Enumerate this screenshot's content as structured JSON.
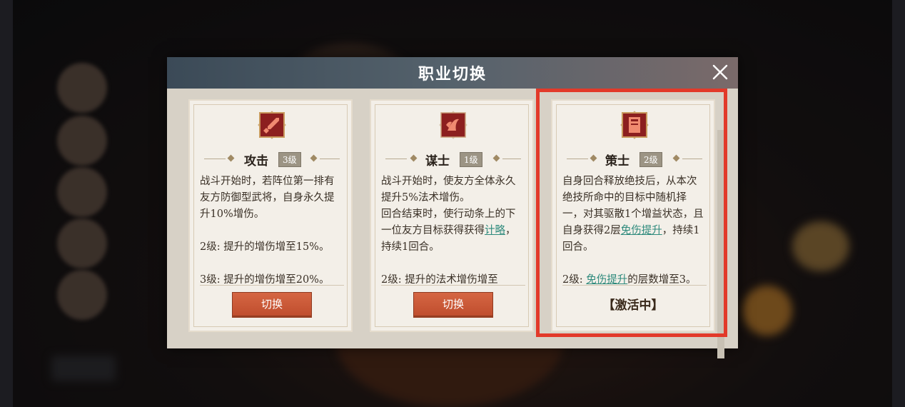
{
  "modal": {
    "title": "职业切换",
    "close_icon": "close-icon"
  },
  "cards": [
    {
      "name": "攻击",
      "level": "3级",
      "icon": "sword-icon",
      "desc": [
        "战斗开始时，若阵位第一排有友方防御型武将，自身永久提升10%增伤。",
        "2级: 提升的增伤增至15%。",
        "3级: 提升的增伤增至20%。"
      ],
      "button": "切换"
    },
    {
      "name": "谋士",
      "level": "1级",
      "icon": "claw-icon",
      "desc_p1": "战斗开始时，使友方全体永久提升5%法术增伤。",
      "desc_p2a": "回合结束时，使行动条上的下一位友方目标获得获得",
      "desc_p2_link": "计略",
      "desc_p2b": "，持续1回合。",
      "desc_p3": "2级: 提升的法术增伤增至",
      "button": "切换"
    },
    {
      "name": "策士",
      "level": "2级",
      "icon": "book-icon",
      "desc_p1a": "自身回合释放绝技后，从本次绝技所命中的目标中随机择一，对其驱散1个增益状态，且自身获得2层",
      "desc_p1_link": "免伤提升",
      "desc_p1b": "，持续1回合。",
      "desc_p2a": "2级: ",
      "desc_p2_link": "免伤提升",
      "desc_p2b": "的层数增至3。",
      "status": "【激活中】"
    }
  ],
  "colors": {
    "accent_button": "#c9552f",
    "highlight_border": "#e23a2a",
    "link": "#2e8a7c"
  }
}
